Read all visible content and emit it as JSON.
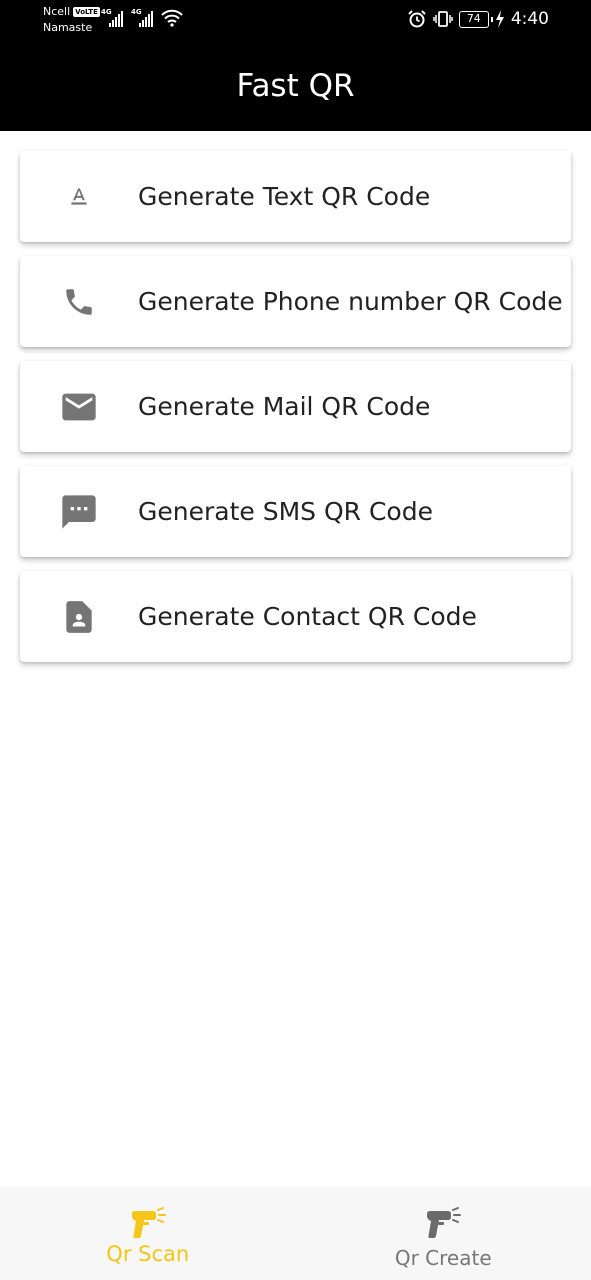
{
  "status_bar": {
    "carrier": "Ncell",
    "volte": "VoLTE",
    "operator": "Namaste",
    "network_1": "4G",
    "network_2": "4G",
    "battery": "74",
    "time": "4:40"
  },
  "app": {
    "title": "Fast QR"
  },
  "menu": [
    {
      "icon": "text-format-icon",
      "label": "Generate Text QR Code"
    },
    {
      "icon": "phone-icon",
      "label": "Generate Phone number QR Code"
    },
    {
      "icon": "mail-icon",
      "label": "Generate Mail QR Code"
    },
    {
      "icon": "sms-icon",
      "label": "Generate SMS QR Code"
    },
    {
      "icon": "contact-icon",
      "label": "Generate Contact QR Code"
    }
  ],
  "bottom_nav": {
    "items": [
      {
        "label": "Qr Scan",
        "icon": "scanner-icon",
        "active": true
      },
      {
        "label": "Qr Create",
        "icon": "scanner-icon",
        "active": false
      }
    ]
  },
  "colors": {
    "accent": "#f5c518",
    "icon_gray": "#757575",
    "inactive_label": "#777777",
    "app_bar": "#000000"
  }
}
